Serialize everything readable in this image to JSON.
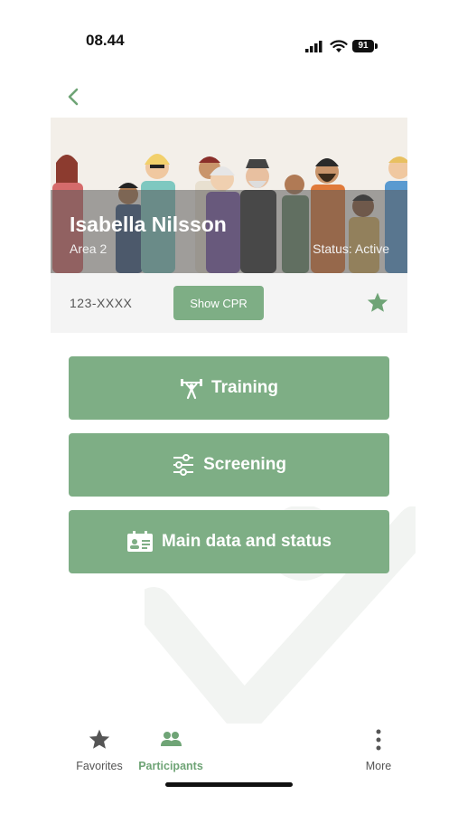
{
  "status_bar": {
    "time": "08.44",
    "battery": "91"
  },
  "participant": {
    "name": "Isabella Nilsson",
    "area": "Area 2",
    "status": "Status: Active",
    "cpr": "123-XXXX",
    "show_cpr_label": "Show CPR"
  },
  "menu": {
    "training_label": "Training",
    "screening_label": "Screening",
    "main_data_label": "Main data and status"
  },
  "tabs": {
    "favorites": "Favorites",
    "participants": "Participants",
    "more": "More"
  },
  "colors": {
    "accent": "#7eae85",
    "active_tab": "#6fa476",
    "inactive_tab": "#555555"
  }
}
